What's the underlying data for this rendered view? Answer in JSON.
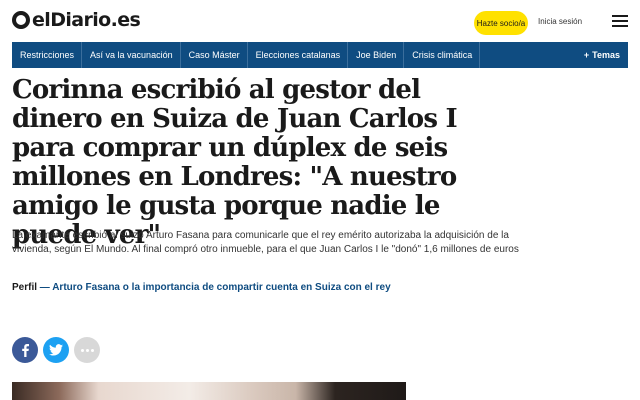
{
  "header": {
    "logo_text": "elDiario.es",
    "subscribe_label": "Hazte socio/a",
    "login_label": "Inicia sesión",
    "menu_icon": "hamburger-icon",
    "subscribe_color": "#ffe100"
  },
  "nav": {
    "items": [
      "Restricciones",
      "Así va la vacunación",
      "Caso Máster",
      "Elecciones catalanas",
      "Joe Biden",
      "Crisis climática"
    ],
    "more_label": "Temas",
    "more_prefix": "+",
    "color": "#0f4c81"
  },
  "article": {
    "headline": "Corinna escribió al gestor del dinero en Suiza de Juan Carlos I para comprar un dúplex de seis millones en Londres: \"A nuestro amigo le gusta porque nadie le puede ver\"",
    "standfirst": "La examante escribió al suizo Arturo Fasana para comunicarle que el rey emérito autorizaba la adquisición de la vivienda, según El Mundo. Al final compró otro inmueble, para el que Juan Carlos I le \"donó\" 1,6 millones de euros",
    "related_label": "Perfil",
    "related_link": "— Arturo Fasana o la importancia de compartir cuenta en Suiza con el rey"
  },
  "share": {
    "facebook_icon": "facebook-icon",
    "twitter_icon": "twitter-icon",
    "more_icon": "more-icon"
  }
}
